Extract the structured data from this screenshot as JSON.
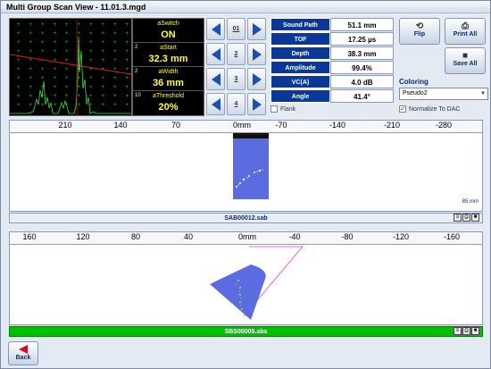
{
  "window": {
    "title": "Multi Group Scan View - 11.01.3.mgd"
  },
  "gates": [
    {
      "num": "",
      "label": "aSwitch",
      "value": "ON"
    },
    {
      "num": "2",
      "label": "aStart",
      "value": "32.3 mm"
    },
    {
      "num": "2",
      "label": "aWidth",
      "value": "36 mm"
    },
    {
      "num": "10",
      "label": "aThreshold",
      "value": "20%"
    }
  ],
  "nav_icons": [
    "01",
    "2",
    "3",
    "4"
  ],
  "measurements": [
    {
      "label": "Sound Path",
      "value": "51.1 mm"
    },
    {
      "label": "TOF",
      "value": "17.25 µs"
    },
    {
      "label": "Depth",
      "value": "38.3 mm"
    },
    {
      "label": "Amplitude",
      "value": "99.4%"
    },
    {
      "label": "VC(A)",
      "value": "4.0 dB"
    },
    {
      "label": "Angle",
      "value": "41.4°"
    }
  ],
  "flank": {
    "label": "Flank",
    "checked": false
  },
  "buttons": {
    "flip": "Flip",
    "print_all": "Print All",
    "save_all": "Save All",
    "back": "Back"
  },
  "coloring": {
    "label": "Coloring",
    "selected": "Pseudo2"
  },
  "normalize": {
    "label": "Normalize To DAC",
    "checked": true
  },
  "scan1": {
    "ticks": [
      "210",
      "140",
      "70",
      "0mm",
      "-70",
      "-140",
      "-210",
      "-280"
    ],
    "depth_label": "85 mm",
    "file": "SAB00012.sab"
  },
  "scan2": {
    "ticks": [
      "160",
      "120",
      "80",
      "40",
      "0mm",
      "-40",
      "-80",
      "-120",
      "-160"
    ],
    "file": "SBS00005.sbs"
  },
  "colors": {
    "accent": "#0a3898",
    "green": "#00c000",
    "scan_blue": "#5b6be0"
  }
}
